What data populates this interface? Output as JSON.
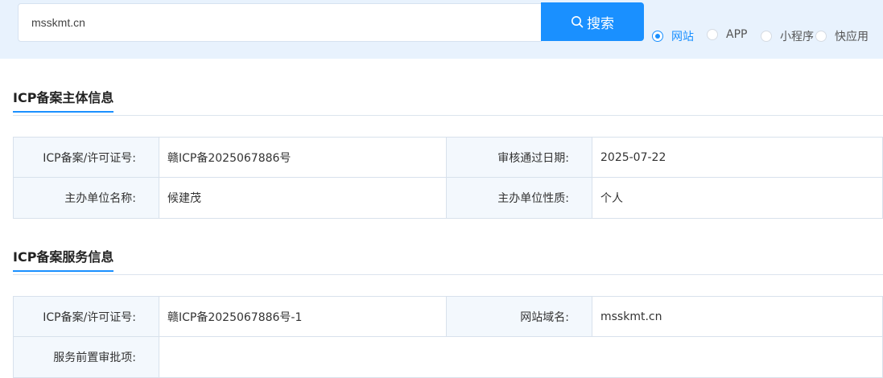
{
  "search": {
    "value": "msskmt.cn",
    "button_label": "搜索"
  },
  "types": [
    {
      "label": "网站",
      "checked": true
    },
    {
      "label": "APP",
      "checked": false
    },
    {
      "label": "小程序",
      "checked": false
    },
    {
      "label": "快应用",
      "checked": false
    }
  ],
  "subject": {
    "title": "ICP备案主体信息",
    "rows": [
      {
        "label1": "ICP备案/许可证号:",
        "value1": "赣ICP备2025067886号",
        "label2": "审核通过日期:",
        "value2": "2025-07-22"
      },
      {
        "label1": "主办单位名称:",
        "value1": "候建茂",
        "label2": "主办单位性质:",
        "value2": "个人"
      }
    ]
  },
  "service": {
    "title": "ICP备案服务信息",
    "rows": [
      {
        "label1": "ICP备案/许可证号:",
        "value1": "赣ICP备2025067886号-1",
        "label2": "网站域名:",
        "value2": "msskmt.cn"
      },
      {
        "label1": "服务前置审批项:",
        "value1": ""
      }
    ]
  },
  "colors": {
    "accent": "#1a90ff",
    "band": "#e8f2fd",
    "label_bg": "#f3f8fd",
    "border": "#d8e1ec"
  }
}
